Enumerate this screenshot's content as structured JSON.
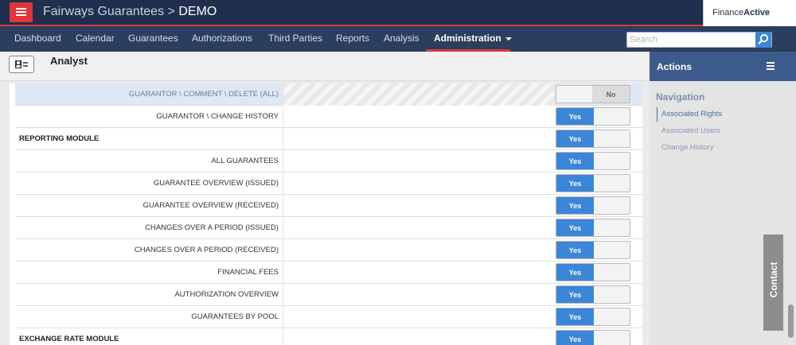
{
  "header": {
    "app_name": "Fairways Guarantees",
    "separator": ">",
    "context": "DEMO",
    "brand_prefix": "Finance",
    "brand_suffix": "Active"
  },
  "nav": {
    "items": [
      {
        "label": "Dashboard"
      },
      {
        "label": "Calendar"
      },
      {
        "label": "Guarantees"
      },
      {
        "label": "Authorizations"
      },
      {
        "label": "Third Parties"
      },
      {
        "label": "Reports"
      },
      {
        "label": "Analysis"
      },
      {
        "label": "Administration"
      }
    ],
    "active_index": 7,
    "search_placeholder": "Search"
  },
  "role": {
    "name": "Analyst"
  },
  "rights": {
    "rows": [
      {
        "label": "GUARANTOR \\ COMMENT \\ DELETE (ALL)",
        "value": "No",
        "section": false,
        "disabled": true
      },
      {
        "label": "GUARANTOR \\ CHANGE HISTORY",
        "value": "Yes",
        "section": false
      },
      {
        "label": "REPORTING MODULE",
        "value": "Yes",
        "section": true
      },
      {
        "label": "ALL GUARANTEES",
        "value": "Yes",
        "section": false
      },
      {
        "label": "GUARANTEE OVERVIEW (ISSUED)",
        "value": "Yes",
        "section": false
      },
      {
        "label": "GUARANTEE OVERVIEW (RECEIVED)",
        "value": "Yes",
        "section": false
      },
      {
        "label": "CHANGES OVER A PERIOD (ISSUED)",
        "value": "Yes",
        "section": false
      },
      {
        "label": "CHANGES OVER A PERIOD (RECEIVED)",
        "value": "Yes",
        "section": false
      },
      {
        "label": "FINANCIAL FEES",
        "value": "Yes",
        "section": false
      },
      {
        "label": "AUTHORIZATION OVERVIEW",
        "value": "Yes",
        "section": false
      },
      {
        "label": "GUARANTEES BY POOL",
        "value": "Yes",
        "section": false
      },
      {
        "label": "EXCHANGE RATE MODULE",
        "value": "Yes",
        "section": true
      }
    ]
  },
  "sidebar": {
    "title": "Actions",
    "nav_title": "Navigation",
    "links": [
      {
        "label": "Associated Rights",
        "active": true
      },
      {
        "label": "Associated Users",
        "active": false
      },
      {
        "label": "Change History",
        "active": false
      }
    ]
  },
  "contact": {
    "label": "Contact"
  },
  "colors": {
    "navy": "#1f2f4d",
    "accent_red": "#e0363b",
    "toggle_blue": "#3b86d9",
    "actions_blue": "#3c5b8c"
  }
}
